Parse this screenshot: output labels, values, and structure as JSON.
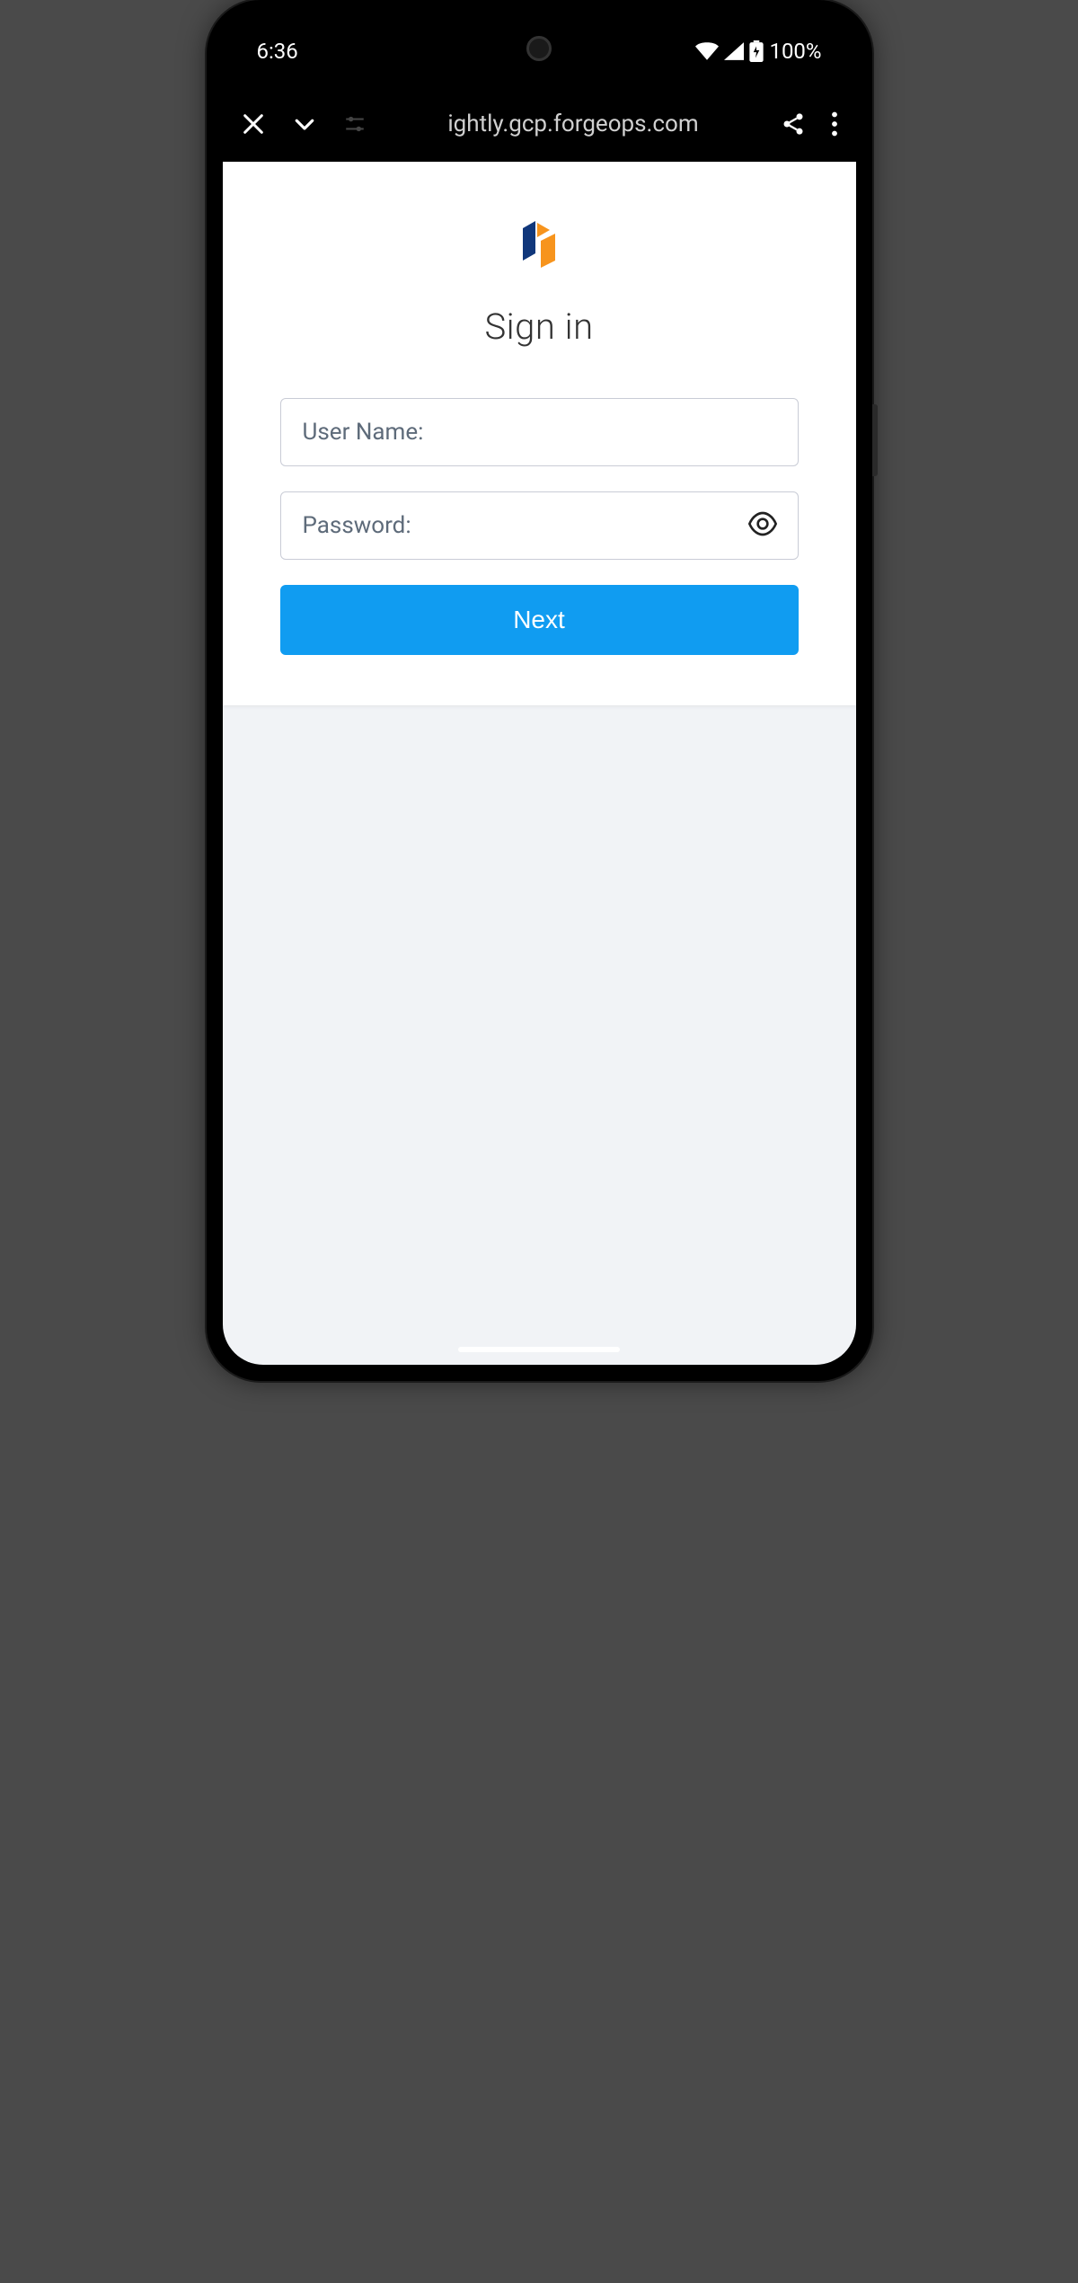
{
  "statusBar": {
    "time": "6:36",
    "battery": "100%"
  },
  "browserBar": {
    "url": "ightly.gcp.forgeops.com"
  },
  "page": {
    "title": "Sign in",
    "usernamePlaceholder": "User Name:",
    "passwordPlaceholder": "Password:",
    "nextButtonLabel": "Next"
  },
  "colors": {
    "primary": "#109cf1",
    "logoOrange": "#F7941D",
    "logoBlue": "#10377B"
  }
}
